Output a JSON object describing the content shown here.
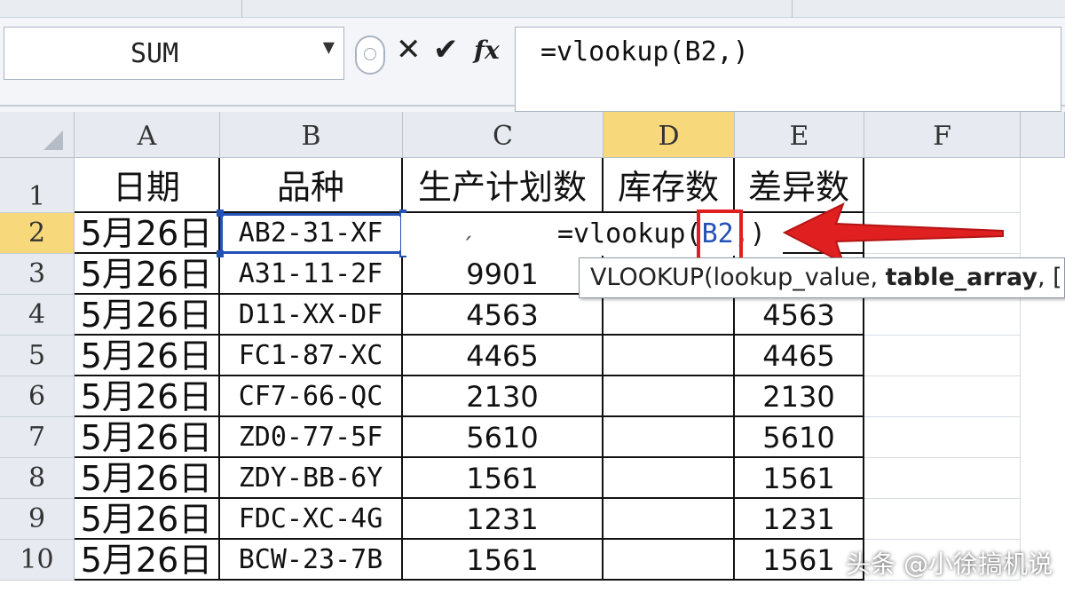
{
  "formula_bar": {
    "name_box": "SUM",
    "buttons": {
      "cancel": "✕",
      "enter": "✔",
      "fx": "fx"
    },
    "formula": "=vlookup(B2,)"
  },
  "columns": [
    "A",
    "B",
    "C",
    "D",
    "E",
    "F"
  ],
  "rows": [
    "1",
    "2",
    "3",
    "4",
    "5",
    "6",
    "7",
    "8",
    "9",
    "10"
  ],
  "header_row": {
    "a": "日期",
    "b": "品种",
    "c": "生产计划数",
    "d": "库存数",
    "e": "差异数"
  },
  "data_rows": [
    {
      "a": "5月26日",
      "b": "AB2-31-XF",
      "c": "",
      "d": "",
      "e": ""
    },
    {
      "a": "5月26日",
      "b": "A31-11-2F",
      "c": "9901",
      "d": "",
      "e": ""
    },
    {
      "a": "5月26日",
      "b": "D11-XX-DF",
      "c": "4563",
      "d": "",
      "e": "4563"
    },
    {
      "a": "5月26日",
      "b": "FC1-87-XC",
      "c": "4465",
      "d": "",
      "e": "4465"
    },
    {
      "a": "5月26日",
      "b": "CF7-66-QC",
      "c": "2130",
      "d": "",
      "e": "2130"
    },
    {
      "a": "5月26日",
      "b": "ZD0-77-5F",
      "c": "5610",
      "d": "",
      "e": "5610"
    },
    {
      "a": "5月26日",
      "b": "ZDY-BB-6Y",
      "c": "1561",
      "d": "",
      "e": "1561"
    },
    {
      "a": "5月26日",
      "b": "FDC-XC-4G",
      "c": "1231",
      "d": "",
      "e": "1231"
    },
    {
      "a": "5月26日",
      "b": "BCW-23-7B",
      "c": "1561",
      "d": "",
      "e": "1561"
    }
  ],
  "in_cell_edit": {
    "prefix": "=vlookup(",
    "ref": "B2,",
    "suffix": ")"
  },
  "tooltip": {
    "func": "VLOOKUP(lookup_value, ",
    "bold_arg": "table_array",
    "rest": ", ["
  },
  "watermark": "头条 @小徐搞机说",
  "colors": {
    "accent": "#2451b6",
    "highlight": "#f7d87a",
    "arrow": "#e02020"
  }
}
